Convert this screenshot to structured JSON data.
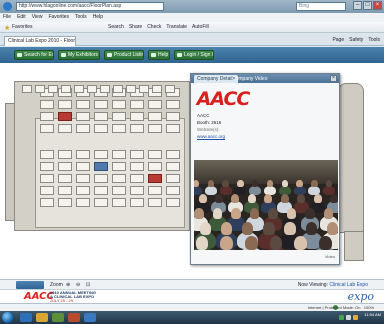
{
  "browser": {
    "url": "http://www.hlagonline.com/aacc/FloorPlan.asp",
    "search_placeholder": "Bing",
    "menu": [
      "File",
      "Edit",
      "View",
      "Favorites",
      "Tools",
      "Help"
    ],
    "favorites_label": "Favorites",
    "command_tools": [
      "Search",
      "Share",
      "Check",
      "Translate",
      "AutoFill"
    ],
    "tab_title": "Clinical Lab Expo 2010 - Floor Plan",
    "command_bar": [
      "Page",
      "Safety",
      "Tools"
    ]
  },
  "app_toolbar": {
    "buttons": [
      "Search for Exhib",
      "My Exhibitors",
      "Product Listing",
      "Help",
      "Login / Sign Up"
    ]
  },
  "popup": {
    "tabs": [
      "Company Details",
      "Company Video"
    ],
    "logo_text": "AACC",
    "company": "AACC",
    "booth": "Booth: 2616",
    "website_label": "Website(s):",
    "website": "www.aacc.org",
    "footer": "Video"
  },
  "zoombar": {
    "zoom_label": "Zoom",
    "right_text": "Now Viewing:",
    "right_link": "Clinical Lab Expo"
  },
  "banner": {
    "logo_text": "AACC",
    "line1": "2010 ANNUAL MEETING",
    "line2": "& CLINICAL LAB EXPO",
    "line3": "JULY 25 - 29",
    "expo_text": "expo"
  },
  "statusbar": {
    "zone": "Internet | Protected Mode: On",
    "zoom": "100%"
  },
  "taskbar": {
    "time": "11:54 AM"
  }
}
